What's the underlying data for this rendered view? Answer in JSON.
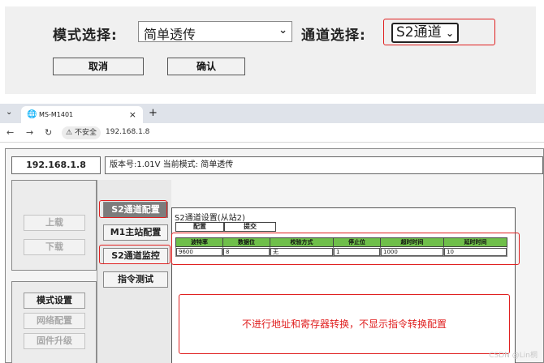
{
  "top_panel": {
    "mode_label": "模式选择:",
    "mode_value": "简单透传",
    "channel_label": "通道选择:",
    "channel_value": "S2通道",
    "cancel_label": "取消",
    "confirm_label": "确认"
  },
  "browser": {
    "tab_title": "MS-M1401",
    "new_tab": "+",
    "close_tab": "×",
    "not_secure": "不安全",
    "url": "192.168.1.8"
  },
  "device": {
    "ip": "192.168.1.8",
    "version_text": "版本号:1.01V 当前模式: 简单透传",
    "upload_label": "上载",
    "download_label": "下载",
    "mode_settings_label": "模式设置",
    "network_config_label": "网络配置",
    "firmware_upgrade_label": "固件升级",
    "nav": [
      "S2通道配置",
      "M1主站配置",
      "S2通道监控",
      "指令测试"
    ],
    "panel_title": "S2通道设置(从站2)",
    "config_tab": "配置",
    "submit_tab": "提交",
    "table": {
      "headers": [
        "波特率",
        "数据位",
        "校验方式",
        "停止位",
        "超时时间",
        "延时时间"
      ],
      "values": [
        "9600",
        "8",
        "无",
        "1",
        "1000",
        "10"
      ]
    },
    "note": "不进行地址和寄存器转换，不显示指令转换配置"
  },
  "watermark": "CSDN @Lin桐"
}
